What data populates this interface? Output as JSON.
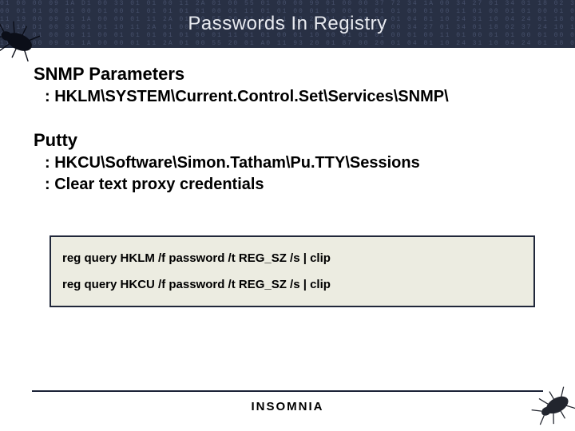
{
  "title": "Passwords In Registry",
  "sections": [
    {
      "heading": "SNMP Parameters",
      "bullets": [
        "HKLM\\SYSTEM\\Current.Control.Set\\Services\\SNMP\\"
      ]
    },
    {
      "heading": "Putty",
      "bullets": [
        "HKCU\\Software\\Simon.Tatham\\Pu.TTY\\Sessions",
        "Clear text proxy credentials"
      ]
    }
  ],
  "commands": [
    "reg query HKLM /f password /t REG_SZ /s | clip",
    "reg query HKCU /f password /t REG_SZ /s | clip"
  ],
  "footer_brand": "INSOMNIA",
  "hex_noise": "01 00 00 09 1A D1 00 33 01 01 00 11 2A 01 00 55 01 00 00 99 01 00 00 37 72 34 1A 00 34 27 01 34 01 18 02 37 24 10 18 17 26 11 11 A7 77 01 27 27 14 16 19 76 01 21 73 01 27 97 01 14 73 01 01 00 01 00 98\n00 01 01 00 11 00 01 00 01 01 01 01 01 00 01 11 01 01 00 01 10 00 01 01 01 00 01 00 11 01 00 01 01 00 01 00 01 01 10 01 00 00 01 00 01 01 01 00 00 01 01 11 00 01 01 01 00 01 11 10 00 01 01 01 10 00 01 01\n11 19 00 09 01 1A 00 00 01 11 2A 01 00 55 20 01 A0 11 93 20 01 87 00 20 01 04 81 10 24 31 10 04 24 01 18 02 37 24 10 01 10 26 11 11 A7 77 01 27 27 14 16 19 76 01 21 73 01 27 97 01 14 73 01 01 00 01 00 98\n09 1A D1 00 33 01 01 10 11 2A 01 00 55 01 00 00 99 01 00 00 37 72 34 1A 00 34 27 01 34 01 18 02 37 24 10 18 17 26 11 11 A7 77 01 27 27 14 16 19 76 01 21 73 01 27 97 01 14 73 01 01 00 01 01 10 00 98 98 01\n01 01 01 00 00 11 00 01 01 01 01 01 00 01 11 01 01 00 01 10 00 01 01 01 00 01 00 11 01 00 01 01 00 01 00 01 01 10 01 00 00 01 00 01 01 01 00 00 01 01 11 00 01 01 01 00 01 11 10 00 01 01 01 10 00 01 01 98\n11 19 00 09 01 1A 00 00 01 11 2A 01 00 55 20 01 A0 11 93 20 01 87 00 20 01 04 81 10 24 31 10 04 24 01 18 02 37 24 10 01 10 26 11 11 A7 77 01 27 27 14 16 19 76 01 21 73 01 27 97 01 14 73 01 01 00 01 00 98"
}
